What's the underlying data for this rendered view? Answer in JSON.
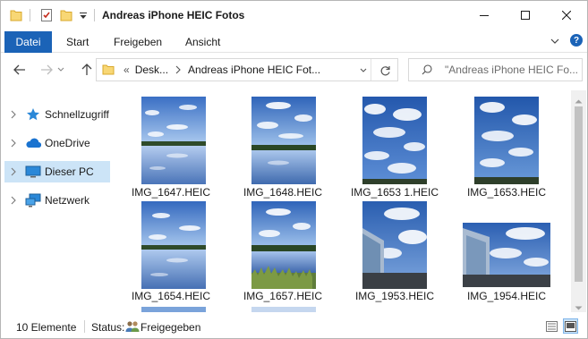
{
  "window": {
    "title": "Andreas iPhone HEIC Fotos",
    "controls": [
      "minimize-icon",
      "maximize-icon",
      "close-icon"
    ]
  },
  "quick_access": [
    "folder-icon",
    "properties-icon",
    "new-folder-icon",
    "dropdown-arrow-icon"
  ],
  "ribbon": {
    "tabs": [
      {
        "label": "Datei",
        "active": true
      },
      {
        "label": "Start"
      },
      {
        "label": "Freigeben"
      },
      {
        "label": "Ansicht"
      }
    ]
  },
  "address": {
    "overflow": "«",
    "crumbs": [
      "Desk...",
      "Andreas iPhone HEIC Fot..."
    ],
    "dropdown_icon": "chevron-down-icon",
    "refresh_icon": "refresh-icon"
  },
  "search": {
    "placeholder": "\"Andreas iPhone HEIC Fo..."
  },
  "sidebar": {
    "items": [
      {
        "label": "Schnellzugriff",
        "icon": "star-icon"
      },
      {
        "label": "OneDrive",
        "icon": "cloud-icon"
      },
      {
        "label": "Dieser PC",
        "icon": "computer-icon",
        "selected": true
      },
      {
        "label": "Netzwerk",
        "icon": "network-icon"
      }
    ]
  },
  "files": [
    {
      "name": "IMG_1647.HEIC"
    },
    {
      "name": "IMG_1648.HEIC"
    },
    {
      "name": "IMG_1653 1.HEIC"
    },
    {
      "name": "IMG_1653.HEIC"
    },
    {
      "name": "IMG_1654.HEIC"
    },
    {
      "name": "IMG_1657.HEIC"
    },
    {
      "name": "IMG_1953.HEIC"
    },
    {
      "name": "IMG_1954.HEIC"
    }
  ],
  "status": {
    "count": "10 Elemente",
    "status_label": "Status:",
    "status_value": "Freigegeben"
  },
  "colors": {
    "accent": "#1b63b7",
    "selection": "#cce4f7"
  }
}
